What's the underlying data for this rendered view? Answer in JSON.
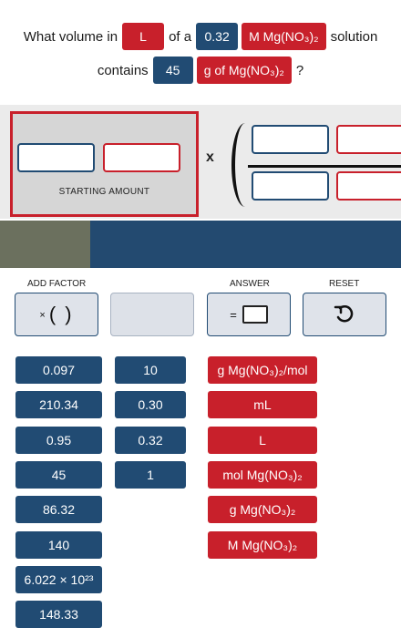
{
  "question": {
    "line1": {
      "text_before": "What volume in",
      "unit_chip": "L",
      "text_mid": "of a",
      "value_chip": "0.32",
      "solution_chip": "M Mg(NO₃)₂",
      "text_after": "solution"
    },
    "line2": {
      "text_before": "contains",
      "value_chip": "45",
      "unit_chip": "g of Mg(NO₃)₂",
      "text_after": "?"
    }
  },
  "workspace": {
    "starting_amount_label": "STARTING AMOUNT",
    "multiply_symbol": "x"
  },
  "toolbar": {
    "add_factor_label": "ADD FACTOR",
    "answer_label": "ANSWER",
    "reset_label": "RESET",
    "factor_symbol": "( )",
    "factor_prefix": "×",
    "equals_symbol": "="
  },
  "tiles": {
    "numbers_col1": [
      "0.097",
      "210.34",
      "0.95",
      "45",
      "86.32",
      "140",
      "6.022 × 10²³",
      "148.33"
    ],
    "numbers_col2": [
      "10",
      "0.30",
      "0.32",
      "1"
    ],
    "units": [
      "g Mg(NO₃)₂/mol",
      "mL",
      "L",
      "mol Mg(NO₃)₂",
      "g Mg(NO₃)₂",
      "M Mg(NO₃)₂"
    ]
  },
  "colors": {
    "red": "#c8202b",
    "blue": "#214b73",
    "band_olive": "#6b705e",
    "band_blue": "#234a70"
  }
}
